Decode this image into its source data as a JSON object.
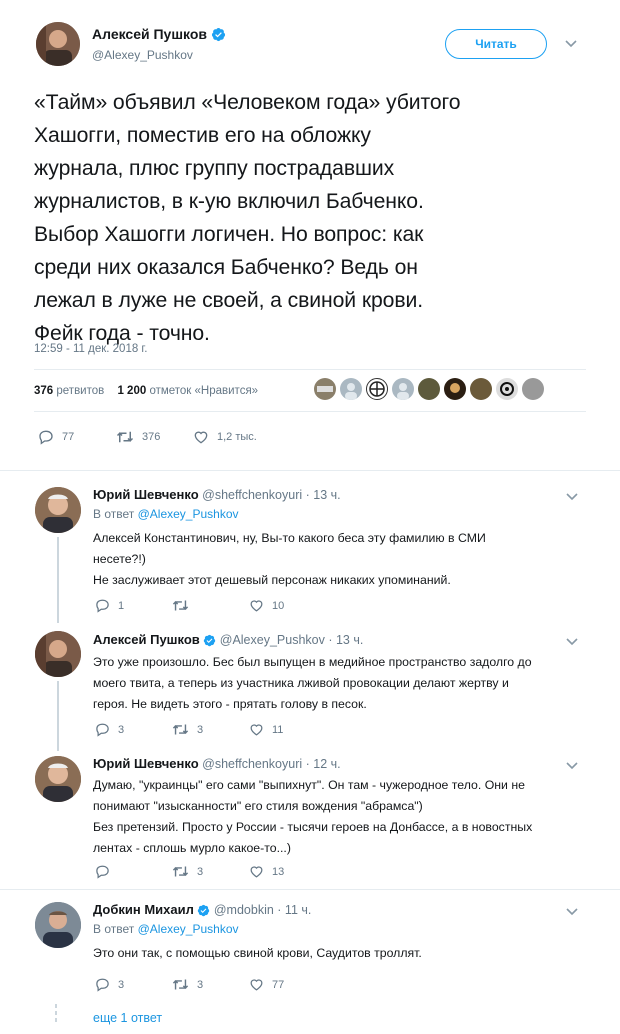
{
  "main": {
    "author_name": "Алексей Пушков",
    "author_handle": "@Alexey_Pushkov",
    "follow_label": "Читать",
    "text_lines": [
      "«Тайм» объявил «Человеком года» убитого",
      "Хашогги, поместив его на обложку",
      "журнала, плюс группу пострадавших",
      "журналистов, в к-ую включил Бабченко.",
      "Выбор Хашогги логичен. Но вопрос: как",
      "среди них оказался Бабченко? Ведь он",
      "лежал в луже не своей, а свиной крови.",
      "Фейк года - точно."
    ],
    "timestamp": "12:59 - 11 дек. 2018 г.",
    "retweets_count": "376",
    "retweets_label": "ретвитов",
    "likes_count": "1 200",
    "likes_label": "отметок «Нравится»",
    "reply_count": "77",
    "retweet_action_count": "376",
    "like_action_count": "1,2 тыс."
  },
  "replies": [
    {
      "name": "Юрий Шевченко",
      "handle": "@sheffchenkoyuri",
      "time": "· 13 ч.",
      "in_reply_label": "В ответ",
      "in_reply_to": "@Alexey_Pushkov",
      "lines": [
        "Алексей Константинович, ну, Вы-то какого беса эту фамилию в СМИ",
        "несете?!)",
        "Не заслуживает этот дешевый персонаж никаких упоминаний."
      ],
      "reply_count": "1",
      "retweet_count": "",
      "like_count": "10"
    },
    {
      "name": "Алексей Пушков",
      "handle": "@Alexey_Pushkov",
      "time": "· 13 ч.",
      "lines": [
        "Это уже произошло. Бес был выпущен в медийное пространство задолго до",
        "моего твита, а теперь из участника лживой провокации делают жертву и",
        "героя. Не видеть этого - прятать голову в песок."
      ],
      "reply_count": "3",
      "retweet_count": "3",
      "like_count": "11"
    },
    {
      "name": "Юрий Шевченко",
      "handle": "@sheffchenkoyuri",
      "time": "· 12 ч.",
      "lines": [
        "Думаю, \"украинцы\" его сами \"выпихнут\". Он там - чужеродное тело. Они не",
        "понимают \"изысканности\" его стиля вождения \"абрамса\")",
        "Без претензий. Просто у России - тысячи героев на Донбассе, а в новостных",
        "лентах - сплошь мурло какое-то...)"
      ],
      "reply_count": "",
      "retweet_count": "3",
      "like_count": "13"
    },
    {
      "name": "Добкин Михаил",
      "handle": "@mdobkin",
      "time": "· 11 ч.",
      "in_reply_label": "В ответ",
      "in_reply_to": "@Alexey_Pushkov",
      "lines": [
        "Это они так, с помощью свиной крови, Саудитов троллят."
      ],
      "reply_count": "3",
      "retweet_count": "3",
      "like_count": "77"
    }
  ],
  "more_replies_label": "еще 1 ответ",
  "colors": {
    "accent": "#1da1f2",
    "link": "#1b95e0",
    "muted": "#657786",
    "divider": "#e6ecf0"
  },
  "icons": {
    "verified": "verified-badge-icon",
    "reply": "reply-icon",
    "retweet": "retweet-icon",
    "like": "heart-icon",
    "more": "chevron-down-icon"
  }
}
